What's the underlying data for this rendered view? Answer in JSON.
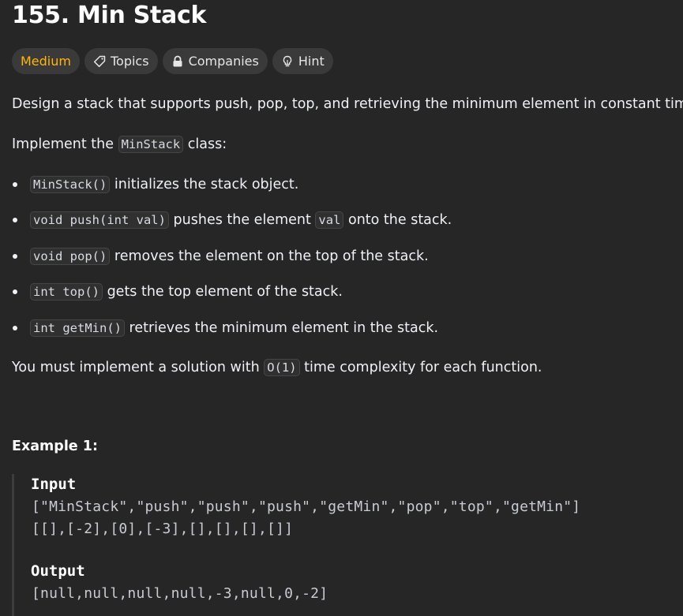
{
  "problem": {
    "title": "155. Min Stack",
    "tags": {
      "difficulty": "Medium",
      "topics": "Topics",
      "companies": "Companies",
      "hint": "Hint"
    },
    "description": {
      "intro": "Design a stack that supports push, pop, top, and retrieving the minimum element in constant time.",
      "implement_prefix": "Implement the ",
      "implement_code": "MinStack",
      "implement_suffix": " class:",
      "methods": [
        {
          "code": "MinStack()",
          "text": " initializes the stack object."
        },
        {
          "code": "void push(int val)",
          "text": " pushes the element ",
          "code2": "val",
          "text2": " onto the stack."
        },
        {
          "code": "void pop()",
          "text": " removes the element on the top of the stack."
        },
        {
          "code": "int top()",
          "text": " gets the top element of the stack."
        },
        {
          "code": "int getMin()",
          "text": " retrieves the minimum element in the stack."
        }
      ],
      "complexity_prefix": "You must implement a solution with ",
      "complexity_code": "O(1)",
      "complexity_suffix": " time complexity for each function."
    },
    "example1": {
      "title": "Example 1:",
      "input_label": "Input",
      "input_line1": "[\"MinStack\",\"push\",\"push\",\"push\",\"getMin\",\"pop\",\"top\",\"getMin\"]",
      "input_line2": "[[],[-2],[0],[-3],[],[],[],[]]",
      "output_label": "Output",
      "output_line": "[null,null,null,null,-3,null,0,-2]"
    }
  },
  "icons": {
    "topics": "tag-icon",
    "companies": "lock-icon",
    "hint": "lightbulb-icon"
  },
  "colors": {
    "background": "#262626",
    "difficulty_medium": "#ffb700",
    "tag_bg": "#3a3a3a",
    "code_bg": "#303030"
  }
}
